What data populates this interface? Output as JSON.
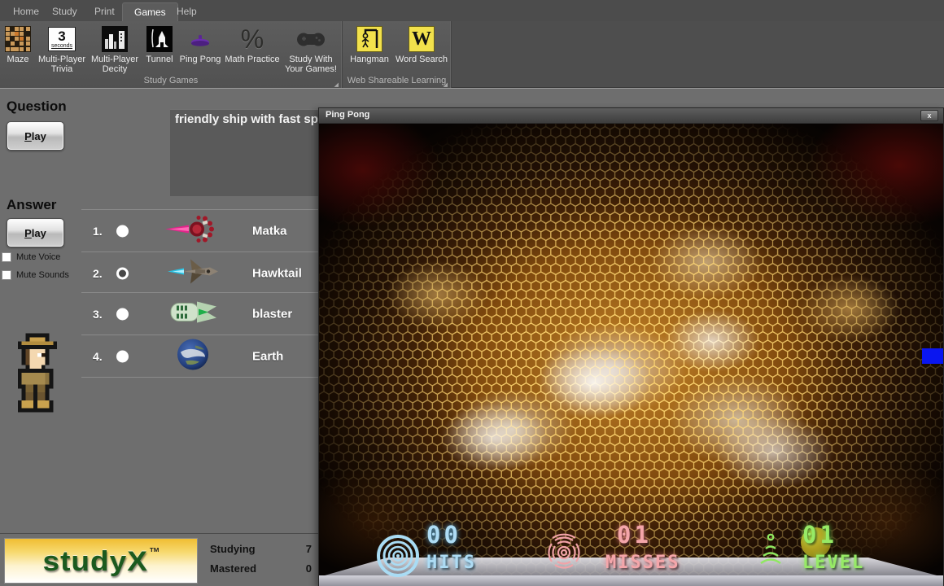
{
  "ribbon": {
    "tabs": [
      {
        "label": "Home",
        "selected": false
      },
      {
        "label": "Study",
        "selected": false
      },
      {
        "label": "Print",
        "selected": false
      },
      {
        "label": "Games",
        "selected": true
      },
      {
        "label": "Help",
        "selected": false
      }
    ],
    "groups": [
      {
        "label": "Study Games",
        "buttons": [
          {
            "label": "Maze"
          },
          {
            "label": "Multi-Player Trivia",
            "icon_top": "3",
            "icon_sub": "seconds"
          },
          {
            "label": "Multi-Player Decity"
          },
          {
            "label": "Tunnel"
          },
          {
            "label": "Ping Pong"
          },
          {
            "label": "Math Practice",
            "icon_glyph": "%"
          },
          {
            "label": "Study With Your Games!"
          }
        ]
      },
      {
        "label": "Web Shareable Learning",
        "buttons": [
          {
            "label": "Hangman"
          },
          {
            "label": "Word Search",
            "icon_letter": "W"
          }
        ]
      }
    ],
    "launcher_glyph": "◢"
  },
  "quiz": {
    "question_heading": "Question",
    "answer_heading": "Answer",
    "play_underline": "P",
    "play_rest": "lay",
    "question_text": "friendly ship with fast spe",
    "mute_voice_label": "Mute Voice",
    "mute_sounds_label": "Mute Sounds",
    "answers": [
      {
        "number": "1.",
        "label": "Matka",
        "selected": false
      },
      {
        "number": "2.",
        "label": "Hawktail",
        "selected": true
      },
      {
        "number": "3.",
        "label": "blaster",
        "selected": false
      },
      {
        "number": "4.",
        "label": "Earth",
        "selected": false
      }
    ],
    "stats": {
      "studying_label": "Studying",
      "studying_value": "7",
      "mastered_label": "Mastered",
      "mastered_value": "0"
    },
    "logo": {
      "text": "studyX",
      "tm": "TM"
    }
  },
  "game_window": {
    "title": "Ping Pong",
    "close_label": "x",
    "hud": {
      "hits": {
        "value": "00",
        "label": "HITS",
        "color": "#aedcf4"
      },
      "misses": {
        "value": "01",
        "label": "MISSES",
        "color": "#f4a6aa"
      },
      "level": {
        "value": "01",
        "label": "LEVEL",
        "color": "#97ea66"
      }
    },
    "paddle_color": "#0a16f0",
    "ball_color": "#b3a321"
  }
}
